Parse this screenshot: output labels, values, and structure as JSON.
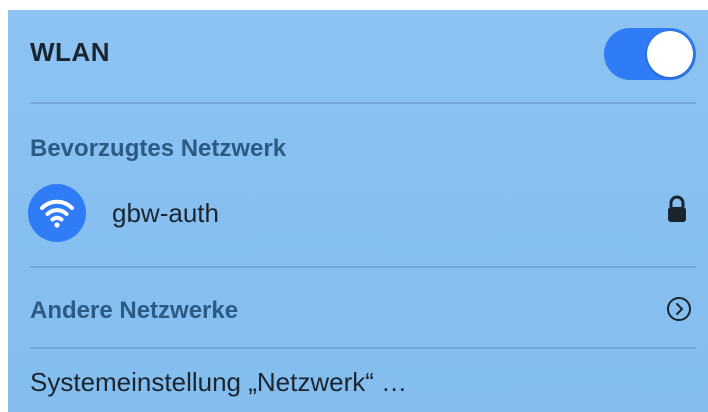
{
  "wlan": {
    "title": "WLAN",
    "toggle_on": true,
    "toggle_color": "#2f7cf6"
  },
  "preferred": {
    "section_title": "Bevorzugtes Netzwerk",
    "network": {
      "name": "gbw-auth",
      "icon": "wifi-icon",
      "secured_icon": "lock-icon"
    }
  },
  "other": {
    "label": "Andere Netzwerke",
    "icon": "chevron-right-circle-icon"
  },
  "settings": {
    "label": "Systemeinstellung „Netzwerk“ …"
  },
  "colors": {
    "panel_background": "#88c0f0",
    "accent": "#2f7cf6",
    "section_text": "#2b5a86",
    "primary_text": "#1b2530"
  }
}
